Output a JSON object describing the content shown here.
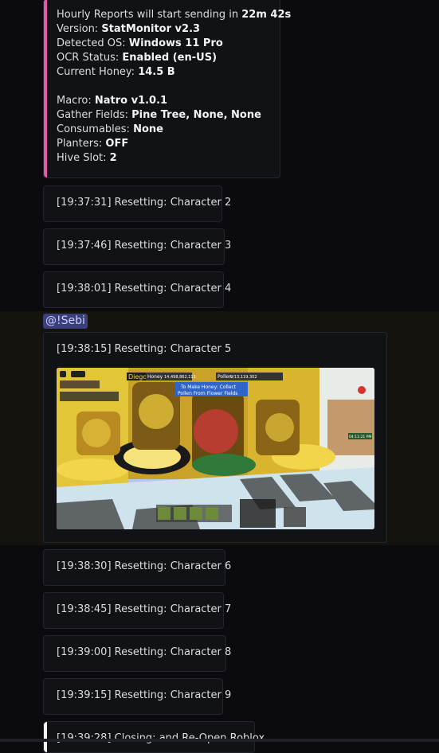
{
  "colors": {
    "status_bar": "#e05ca8",
    "closing_bar": "#f2f3f5",
    "mention_bg": "#3a3f7a"
  },
  "status": {
    "hourly_prefix": "Hourly Reports will start sending in ",
    "hourly_value": "22m 42s",
    "version_label": "Version: ",
    "version_value": "StatMonitor v2.3",
    "os_label": "Detected OS: ",
    "os_value": "Windows 11 Pro",
    "ocr_label": "OCR Status: ",
    "ocr_value": "Enabled (en-US)",
    "honey_label": "Current Honey: ",
    "honey_value": "14.5 B",
    "macro_label": "Macro: ",
    "macro_value": "Natro v1.0.1",
    "fields_label": "Gather Fields: ",
    "fields_value": "Pine Tree, None, None",
    "consumables_label": "Consumables: ",
    "consumables_value": "None",
    "planters_label": "Planters: ",
    "planters_value": "OFF",
    "hive_label": "Hive Slot: ",
    "hive_value": "2"
  },
  "messages": [
    "[19:37:31] Resetting: Character 2",
    "[19:37:46] Resetting: Character 3",
    "[19:38:01] Resetting: Character 4",
    "[19:38:15] Resetting: Character 5",
    "[19:38:30] Resetting: Character 6",
    "[19:38:45] Resetting: Character 7",
    "[19:39:00] Resetting: Character 8",
    "[19:39:15] Resetting: Character 9",
    "[19:39:28] Closing: and Re-Open Roblox"
  ],
  "mention": "@!Sebi",
  "game": {
    "player_name": "Diego",
    "honey_tag": "Honey",
    "honey_amount": "14,498,862,111",
    "pollen_tag": "Pollen",
    "pollen_amount": "0/13,119,302",
    "tip_line1": "To Make Honey: Collect",
    "tip_line2": "Pollen From Flower Fields",
    "clock": "04:11:21 PM"
  }
}
